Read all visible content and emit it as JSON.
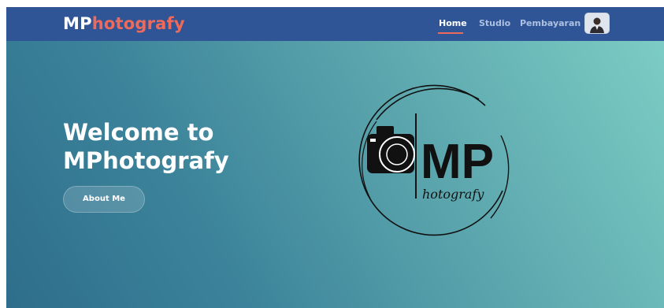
{
  "navbar": {
    "brand_prefix": "MP",
    "brand_suffix": "hotografy",
    "links": [
      {
        "label": "Home",
        "active": true
      },
      {
        "label": "Studio",
        "active": false
      },
      {
        "label": "Pembayaran",
        "active": false
      }
    ],
    "avatar_icon": "user-avatar-icon"
  },
  "hero": {
    "title_line1": "Welcome to",
    "title_line2": "MPhotografy",
    "button_label": "About Me",
    "logo_letters": "MP",
    "logo_script": "hotografy",
    "logo_icon": "camera-icon"
  },
  "colors": {
    "navbar": "#2f5597",
    "accent": "#ef6a5a",
    "hero_start": "#2e6e8c",
    "hero_end": "#7ccdc4"
  }
}
